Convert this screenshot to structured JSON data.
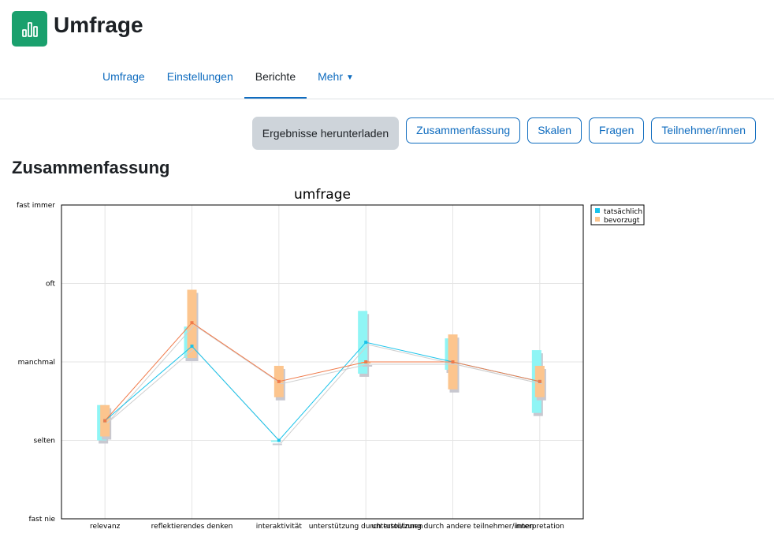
{
  "header": {
    "title": "Umfrage",
    "icon": "chart-bar-icon",
    "brand_color": "#1aa06d"
  },
  "nav": {
    "tabs": [
      {
        "label": "Umfrage",
        "active": false
      },
      {
        "label": "Einstellungen",
        "active": false
      },
      {
        "label": "Berichte",
        "active": true
      },
      {
        "label": "Mehr",
        "active": false,
        "dropdown": true
      }
    ]
  },
  "toolbar": {
    "download_label": "Ergebnisse herunterladen",
    "summary_label": "Zusammenfassung",
    "scales_label": "Skalen",
    "questions_label": "Fragen",
    "participants_label": "Teilnehmer/innen"
  },
  "section_title": "Zusammenfassung",
  "chart_data": {
    "type": "line",
    "title": "umfrage",
    "categories": [
      "relevanz",
      "reflektierendes denken",
      "interaktivität",
      "unterstützung durch tutor/innen",
      "unterstützung durch andere teilnehmer/innen",
      "interpretation"
    ],
    "y_ticks": [
      "fast nie",
      "selten",
      "manchmal",
      "oft",
      "fast immer"
    ],
    "ylim": [
      1,
      5
    ],
    "grid": true,
    "legend_position": "top-right",
    "series": [
      {
        "name": "tatsächlich",
        "color": "#19c3ea",
        "band_color": "#8ff5f5",
        "values": [
          2.25,
          3.2,
          2.0,
          3.25,
          3.0,
          2.75
        ],
        "range": [
          [
            2.0,
            2.45
          ],
          [
            3.05,
            3.45
          ],
          [
            2.0,
            2.0
          ],
          [
            2.85,
            3.65
          ],
          [
            2.9,
            3.3
          ],
          [
            2.35,
            3.15
          ]
        ]
      },
      {
        "name": "bevorzugt",
        "color": "#f07a4a",
        "band_color": "#fcc58e",
        "values": [
          2.25,
          3.5,
          2.75,
          3.0,
          3.0,
          2.75
        ],
        "range": [
          [
            2.05,
            2.45
          ],
          [
            3.05,
            3.92
          ],
          [
            2.55,
            2.95
          ],
          [
            3.0,
            3.0
          ],
          [
            2.65,
            3.35
          ],
          [
            2.55,
            2.95
          ]
        ]
      }
    ]
  }
}
